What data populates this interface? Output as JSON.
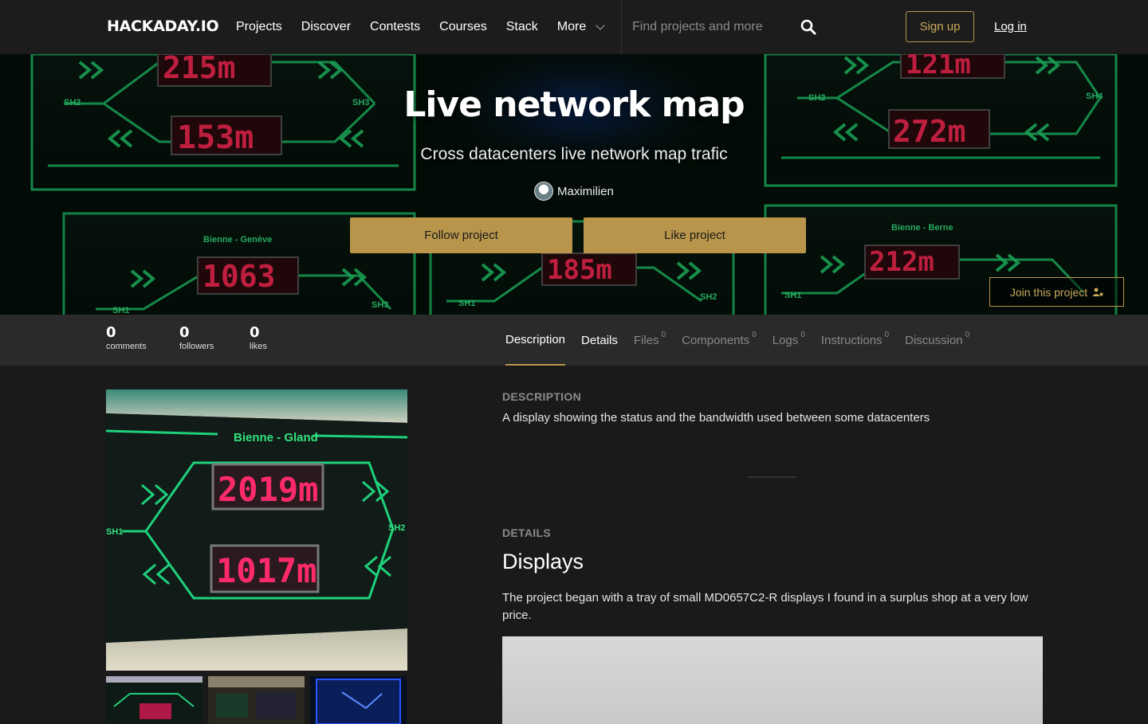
{
  "nav": {
    "logo": "HACKADAY.IO",
    "links": [
      "Projects",
      "Discover",
      "Contests",
      "Courses",
      "Stack",
      "More"
    ],
    "search_placeholder": "Find projects and more",
    "signup": "Sign up",
    "login": "Log in"
  },
  "hero": {
    "title": "Live network map",
    "subtitle": "Cross datacenters live network map trafic",
    "author": "Maximilien",
    "follow": "Follow project",
    "like": "Like project",
    "join": "Join this project"
  },
  "stats": [
    {
      "num": "0",
      "label": "comments"
    },
    {
      "num": "0",
      "label": "followers"
    },
    {
      "num": "0",
      "label": "likes"
    }
  ],
  "tabs": [
    {
      "label": "Description",
      "count": ""
    },
    {
      "label": "Details",
      "count": ""
    },
    {
      "label": "Files",
      "count": "0"
    },
    {
      "label": "Components",
      "count": "0"
    },
    {
      "label": "Logs",
      "count": "0"
    },
    {
      "label": "Instructions",
      "count": "0"
    },
    {
      "label": "Discussion",
      "count": "0"
    }
  ],
  "description": {
    "heading": "DESCRIPTION",
    "text": "A display showing the status and the bandwidth used between some datacenters"
  },
  "details": {
    "heading": "DETAILS",
    "title": "Displays",
    "text": "The project began with a tray of small MD0657C2-R displays I found in a surplus shop at a very low price."
  },
  "gallery": {
    "main_label": "Bienne - Gland",
    "main_top": "2019m",
    "main_bottom": "1017m",
    "sh_left": "SH1",
    "sh_right": "SH2"
  },
  "hero_panels": {
    "top_left": "215m",
    "mid_left": "153m",
    "top_right": "121m",
    "mid_right": "272m",
    "bl_label": "Bienne - Genève",
    "bl_value": "1063",
    "bc_value": "185m",
    "br_label": "Bienne - Berne",
    "br_value": "212m",
    "sh1": "SH1",
    "sh2": "SH2",
    "sh3": "SH3",
    "sh4": "SH4"
  }
}
